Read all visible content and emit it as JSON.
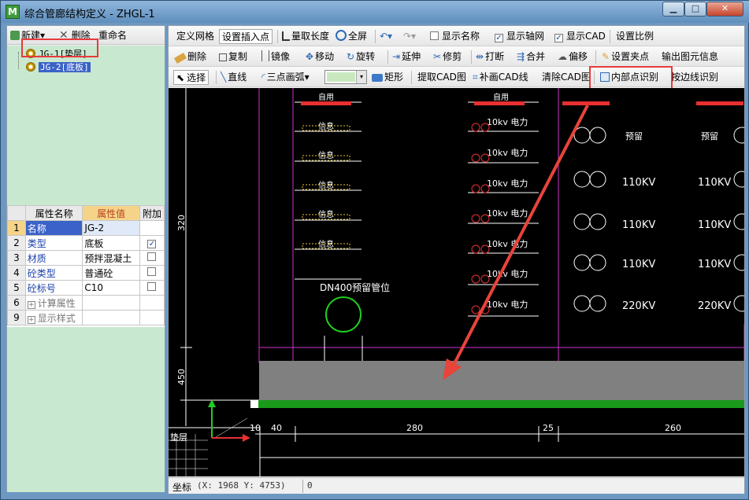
{
  "window": {
    "icon_letter": "M",
    "title": "综合管廊结构定义 - ZHGL-1",
    "min_glyph": "▁",
    "max_glyph": "□",
    "close_glyph": "✕"
  },
  "left_toolbar": {
    "new_label": "新建",
    "new_arrow": "▾",
    "delete_label": "删除",
    "rename_label": "重命名"
  },
  "tree": {
    "items": [
      {
        "label": "JG-1[垫层]"
      },
      {
        "label": "JG-2[底板]"
      }
    ]
  },
  "properties": {
    "header_name": "属性名称",
    "header_value": "属性值",
    "header_extra": "附加",
    "rows": [
      {
        "num": "1",
        "name": "名称",
        "value": "JG-2"
      },
      {
        "num": "2",
        "name": "类型",
        "value": "底板"
      },
      {
        "num": "3",
        "name": "材质",
        "value": "预拌混凝土"
      },
      {
        "num": "4",
        "name": "砼类型",
        "value": "普通砼"
      },
      {
        "num": "5",
        "name": "砼标号",
        "value": "C10"
      },
      {
        "num": "6",
        "name": "计算属性",
        "value": ""
      },
      {
        "num": "9",
        "name": "显示样式",
        "value": ""
      }
    ],
    "expand_glyph": "+",
    "check_glyph": "✓"
  },
  "toolbar1": {
    "define_grid": "定义网格",
    "set_insert_point": "设置插入点",
    "measure_length": "量取长度",
    "fullscreen": "全屏",
    "show_name": "显示名称",
    "show_axis": "显示轴网",
    "show_cad": "显示CAD",
    "set_scale": "设置比例"
  },
  "toolbar2": {
    "delete": "删除",
    "copy": "复制",
    "mirror": "镜像",
    "move": "移动",
    "rotate": "旋转",
    "extend": "延伸",
    "trim": "修剪",
    "break": "打断",
    "merge": "合并",
    "offset": "偏移",
    "set_clamp": "设置夹点",
    "export_info": "输出图元信息"
  },
  "toolbar3": {
    "select": "选择",
    "line": "直线",
    "arc3": "三点画弧",
    "dropdown_arrow": "▾",
    "rect": "矩形",
    "extract_cad": "提取CAD图",
    "redraw_cad": "补画CAD线",
    "clear_cad": "清除CAD图",
    "inner_point": "内部点识别",
    "by_edge": "按边线识别"
  },
  "canvas": {
    "label_320": "320",
    "label_450": "450",
    "label_zi_yong": "自用",
    "label_xin_xi": "信息",
    "label_10kv": "10kv 电力",
    "label_dn400": "DN400预留管位",
    "label_yu_liu": "预留",
    "label_110kv": "110KV",
    "label_220kv": "220KV",
    "dim_10": "10",
    "dim_40": "40",
    "dim_280": "280",
    "dim_25": "25",
    "dim_260": "260",
    "corner_label": "垫层"
  },
  "status": {
    "coord_label": "坐标",
    "coord_value": "(X: 1968 Y: 4753)",
    "extra": "0"
  },
  "colors": {
    "highlight_red": "#e83a3a",
    "cad_magenta": "#cc33cc",
    "cad_red": "#e83030",
    "cad_yellow": "#e8c430",
    "floor_gray": "#808080",
    "base_green": "#1a9a1a"
  }
}
